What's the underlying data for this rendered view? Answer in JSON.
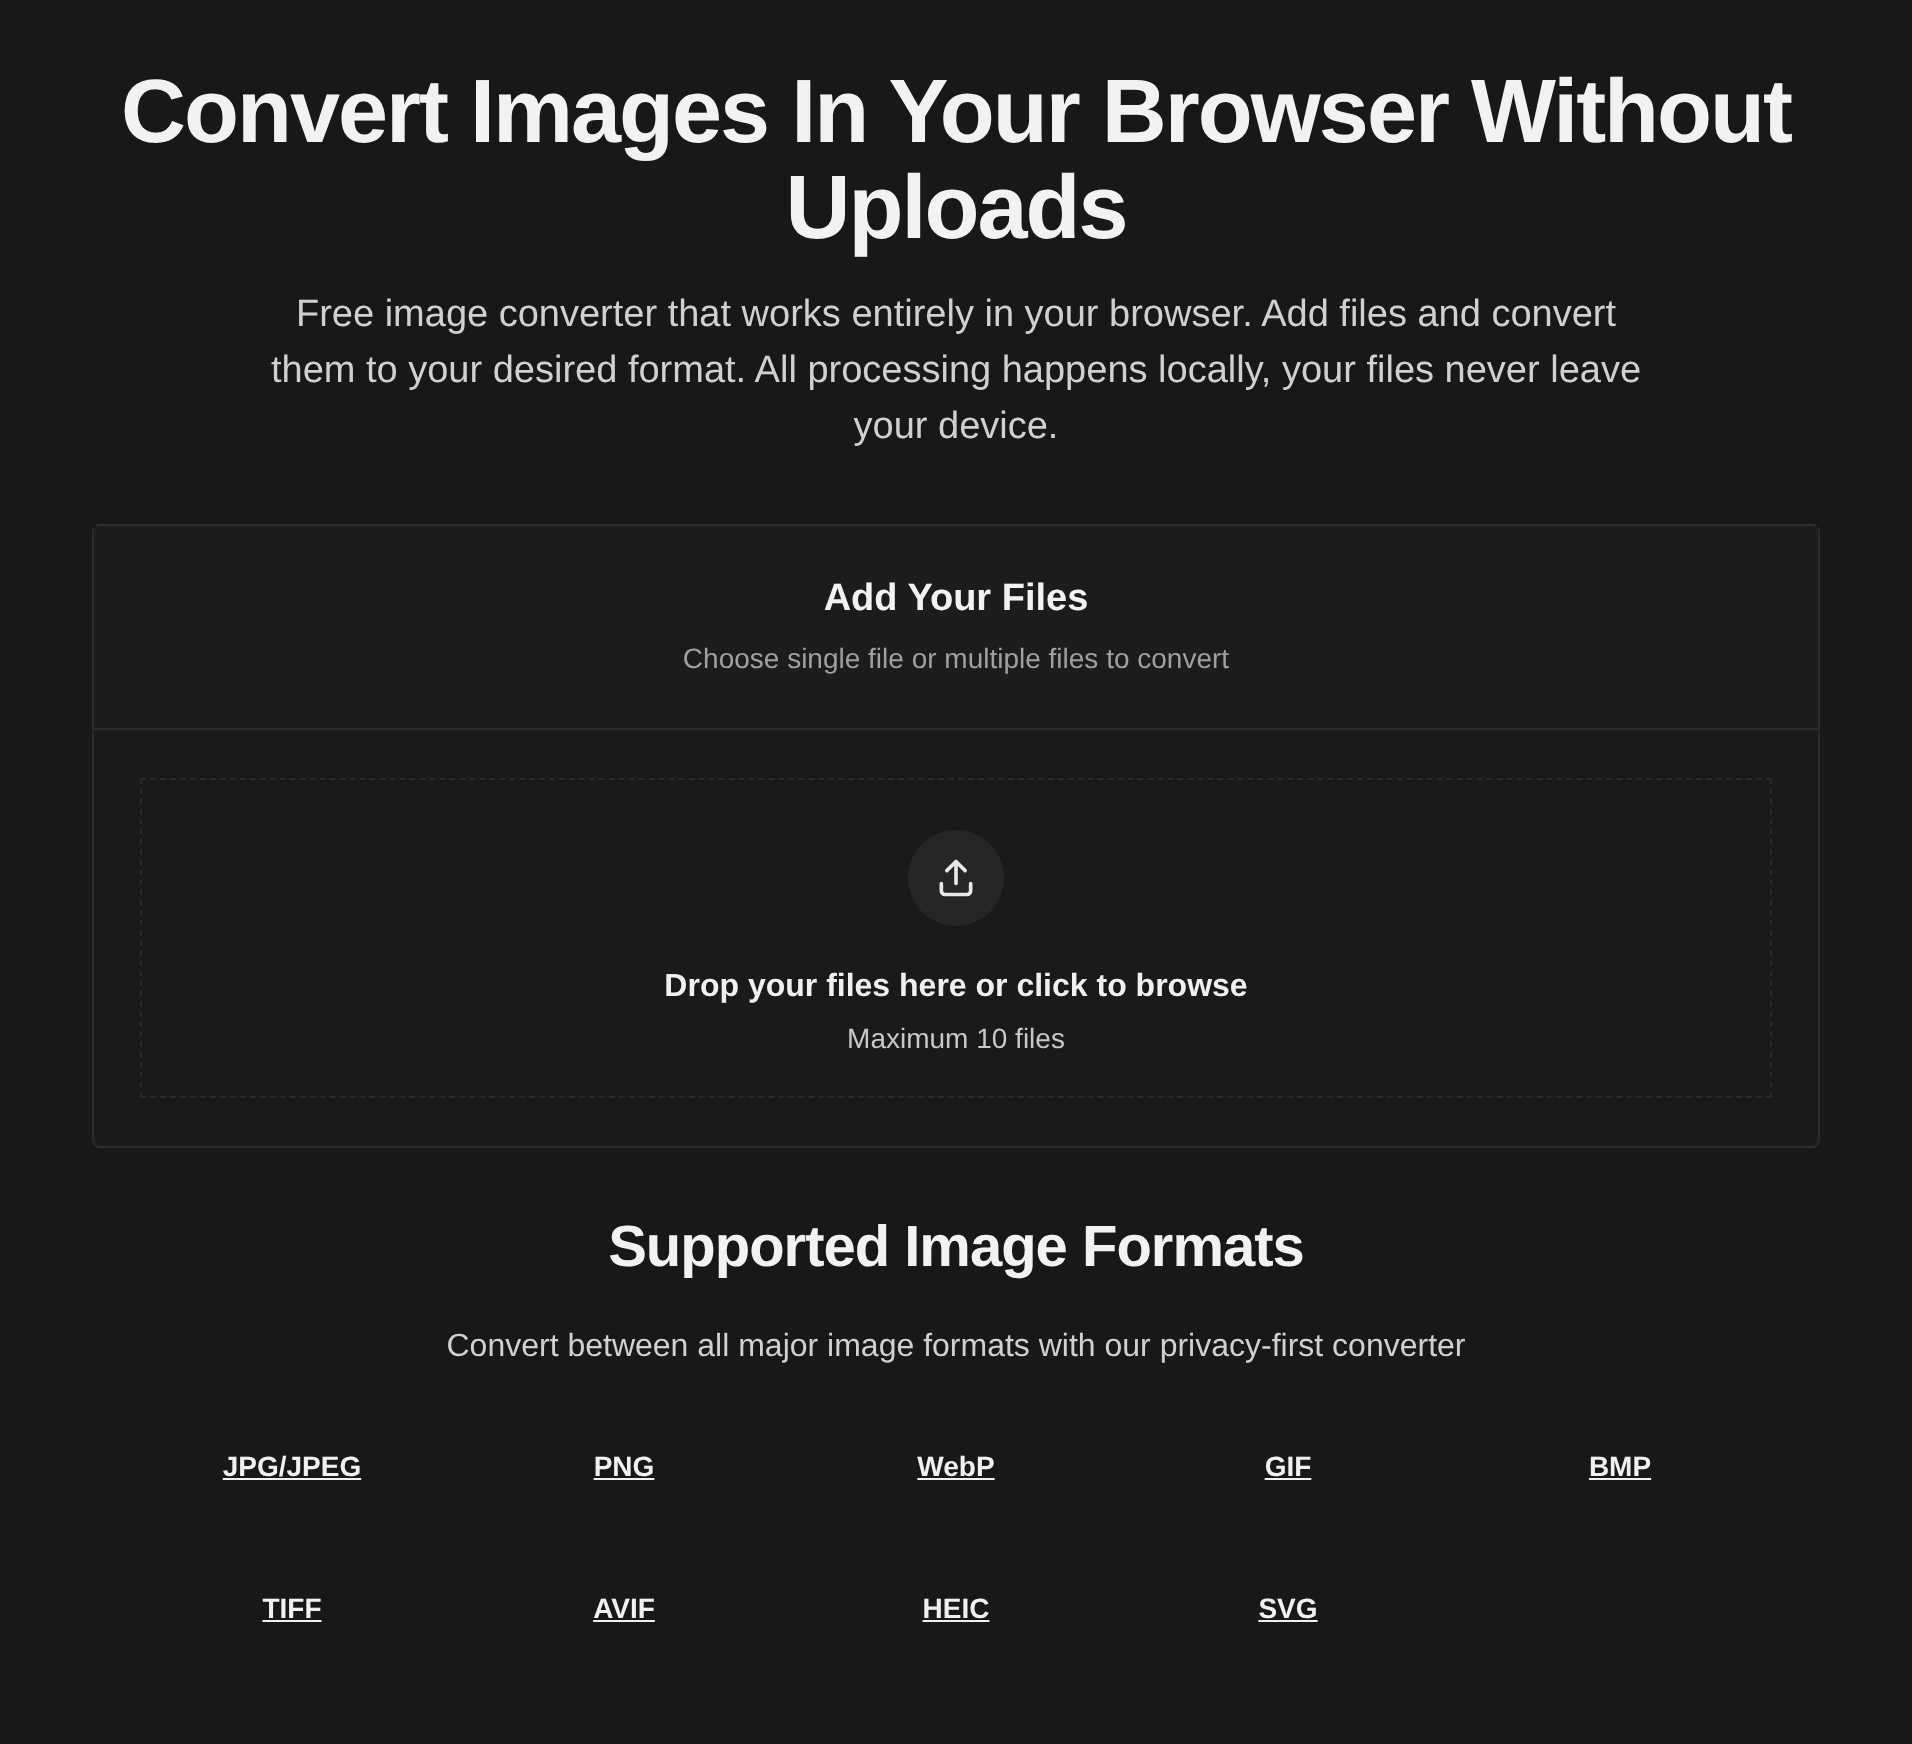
{
  "hero": {
    "title": "Convert Images In Your Browser Without Uploads",
    "subtitle": "Free image converter that works entirely in your browser. Add files and convert them to your desired format. All processing happens locally, your files never leave your device."
  },
  "upload_card": {
    "title": "Add Your Files",
    "subtitle": "Choose single file or multiple files to convert",
    "dropzone_text": "Drop your files here or click to browse",
    "dropzone_hint": "Maximum 10 files"
  },
  "formats": {
    "title": "Supported Image Formats",
    "subtitle": "Convert between all major image formats with our privacy-first converter",
    "items": [
      "JPG/JPEG",
      "PNG",
      "WebP",
      "GIF",
      "BMP",
      "TIFF",
      "AVIF",
      "HEIC",
      "SVG"
    ]
  }
}
